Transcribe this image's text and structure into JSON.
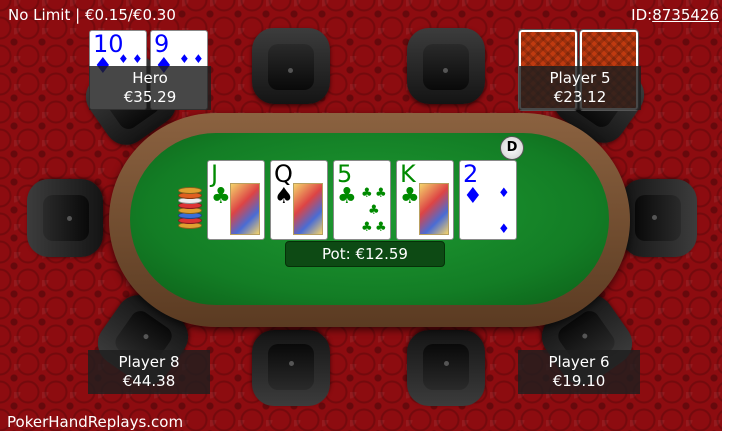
{
  "header": {
    "game": "No Limit | €0.15/€0.30",
    "id_label": "ID:",
    "id_value": "8735426"
  },
  "footer": {
    "brand": "PokerHandReplays.com"
  },
  "board": [
    {
      "rank": "J",
      "suit": "♣",
      "suit_name": "clubs"
    },
    {
      "rank": "Q",
      "suit": "♠",
      "suit_name": "spades"
    },
    {
      "rank": "5",
      "suit": "♣",
      "suit_name": "clubs"
    },
    {
      "rank": "K",
      "suit": "♣",
      "suit_name": "clubs"
    },
    {
      "rank": "2",
      "suit": "♦",
      "suit_name": "diamonds"
    }
  ],
  "pot": "Pot: €12.59",
  "dealer": "D",
  "players": [
    {
      "name": "Hero",
      "stack": "€35.29",
      "cards": [
        {
          "rank": "10",
          "suit": "♦"
        },
        {
          "rank": "9",
          "suit": "♦"
        }
      ]
    },
    {
      "name": "Player 5",
      "stack": "€23.12",
      "cards": "face-down"
    },
    {
      "name": "Player 8",
      "stack": "€44.38"
    },
    {
      "name": "Player 6",
      "stack": "€19.10"
    }
  ],
  "colors": {
    "felt": "#137d25",
    "background": "#8d0c10",
    "rail": "#7a5234",
    "pot_box": "#0d4a14"
  }
}
